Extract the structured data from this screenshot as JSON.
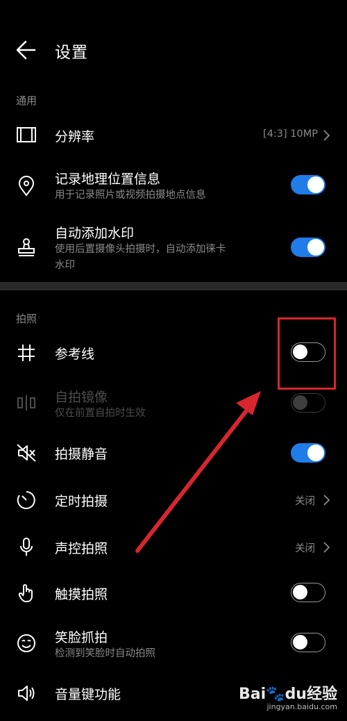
{
  "header": {
    "title": "设置"
  },
  "sections": {
    "general": "通用",
    "photo": "拍照"
  },
  "general": {
    "resolution": {
      "label": "分辨率",
      "value": "[4:3] 10MP"
    },
    "location": {
      "label": "记录地理位置信息",
      "sub": "用于记录照片或视频拍摄地点信息",
      "on": true
    },
    "watermark": {
      "label": "自动添加水印",
      "sub1": "使用后置摄像头拍摄时，自动添加徕卡",
      "sub2": "水印",
      "on": true
    }
  },
  "photo": {
    "gridlines": {
      "label": "参考线",
      "on": false
    },
    "mirror": {
      "label": "自拍镜像",
      "sub": "仅在前置自拍时生效",
      "enabled": false
    },
    "mute": {
      "label": "拍摄静音",
      "on": true
    },
    "timer": {
      "label": "定时拍摄",
      "value": "关闭"
    },
    "voice": {
      "label": "声控拍照",
      "value": "关闭"
    },
    "touch": {
      "label": "触摸拍照",
      "on": false
    },
    "smile": {
      "label": "笑脸抓拍",
      "sub": "检测到笑脸时自动拍照",
      "on": false
    },
    "volume": {
      "label": "音量键功能"
    }
  },
  "watermark_badge": {
    "brand_a": "Bai",
    "brand_b": "du",
    "brand_c": "经验",
    "url": "jingyan.baidu.com"
  },
  "colors": {
    "accent": "#1f7ce8",
    "annotation": "#d7262e"
  }
}
